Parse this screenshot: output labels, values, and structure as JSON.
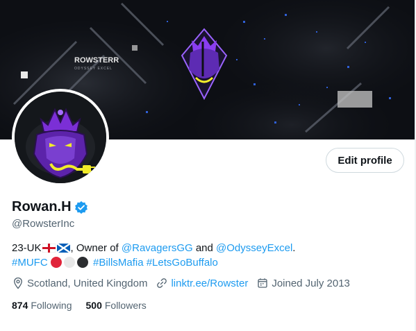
{
  "profile": {
    "display_name": "Rowan.H",
    "handle": "@RowsterInc",
    "edit_label": "Edit profile",
    "banner_text": "ROWSTERR",
    "banner_subtext": "ODYSSEY EXCEL"
  },
  "bio": {
    "prefix": "23-UK",
    "owner_text": ", Owner of ",
    "mention_1": "@RavagersGG",
    "and_text": " and ",
    "mention_2": "@OdysseyExcel",
    "period": ".",
    "hashtag_1": "#MUFC",
    "hashtag_2": "#BillsMafia",
    "hashtag_3": "#LetsGoBuffalo",
    "dot_colors": [
      "#e0243a",
      "#e8e8e8",
      "#2b2d30"
    ]
  },
  "meta": {
    "location": "Scotland, United Kingdom",
    "link": "linktr.ee/Rowster",
    "joined": "Joined July 2013"
  },
  "stats": {
    "following_count": "874",
    "following_label": "Following",
    "followers_count": "500",
    "followers_label": "Followers"
  },
  "colors": {
    "accent": "#1d9bf0",
    "text_secondary": "#536471",
    "logo_purple": "#7b2fd6",
    "logo_yellow": "#f2ec2a"
  }
}
